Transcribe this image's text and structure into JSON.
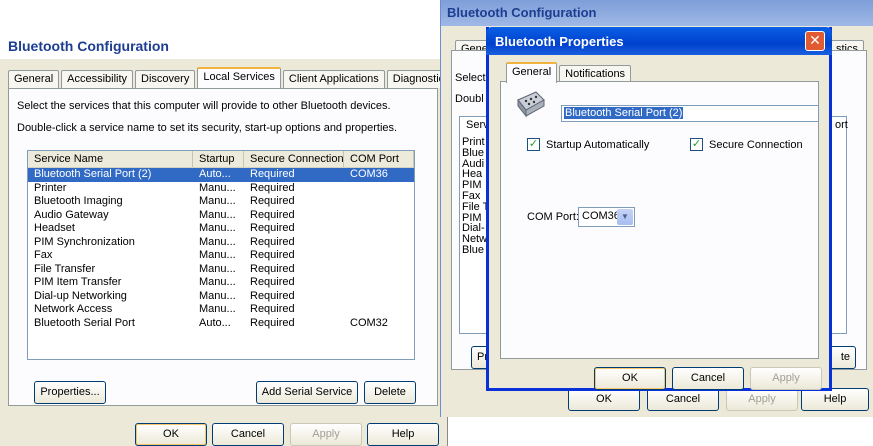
{
  "left_window": {
    "title": "Bluetooth Configuration",
    "tabs": [
      "General",
      "Accessibility",
      "Discovery",
      "Local Services",
      "Client Applications",
      "Diagnostics"
    ],
    "active_tab": "Local Services",
    "intro_line1": "Select the services that this computer will provide to other Bluetooth devices.",
    "intro_line2": "Double-click a service name to set its security, start-up options and properties.",
    "columns": [
      "Service Name",
      "Startup",
      "Secure Connection",
      "COM Port"
    ],
    "rows": [
      {
        "name": "Bluetooth Serial Port (2)",
        "startup": "Auto...",
        "secure": "Required",
        "port": "COM36"
      },
      {
        "name": "Printer",
        "startup": "Manu...",
        "secure": "Required",
        "port": ""
      },
      {
        "name": "Bluetooth Imaging",
        "startup": "Manu...",
        "secure": "Required",
        "port": ""
      },
      {
        "name": "Audio Gateway",
        "startup": "Manu...",
        "secure": "Required",
        "port": ""
      },
      {
        "name": "Headset",
        "startup": "Manu...",
        "secure": "Required",
        "port": ""
      },
      {
        "name": "PIM Synchronization",
        "startup": "Manu...",
        "secure": "Required",
        "port": ""
      },
      {
        "name": "Fax",
        "startup": "Manu...",
        "secure": "Required",
        "port": ""
      },
      {
        "name": "File Transfer",
        "startup": "Manu...",
        "secure": "Required",
        "port": ""
      },
      {
        "name": "PIM Item Transfer",
        "startup": "Manu...",
        "secure": "Required",
        "port": ""
      },
      {
        "name": "Dial-up Networking",
        "startup": "Manu...",
        "secure": "Required",
        "port": ""
      },
      {
        "name": "Network Access",
        "startup": "Manu...",
        "secure": "Required",
        "port": ""
      },
      {
        "name": "Bluetooth Serial Port",
        "startup": "Auto...",
        "secure": "Required",
        "port": "COM32"
      }
    ],
    "properties_label": "Properties...",
    "add_serial_label": "Add Serial Service",
    "delete_label": "Delete",
    "ok_label": "OK",
    "cancel_label": "Cancel",
    "apply_label": "Apply",
    "help_label": "Help"
  },
  "right_window": {
    "title": "Bluetooth Configuration",
    "tab_general": "General",
    "tab_diagnostics_fragment": "stics",
    "select_fragment": "Select",
    "double_fragment": "Doubl",
    "serv_fragment": "Serv",
    "port_fragment": "ort",
    "list_fragments": [
      "Print",
      "Blue",
      "Audi",
      "Hea",
      "PIM",
      "Fax",
      "File T",
      "PIM",
      "Dial-",
      "Netw",
      "Blue"
    ],
    "properties_fragment": "Pro",
    "delete_fragment": "te",
    "ok_label": "OK",
    "cancel_label": "Cancel",
    "apply_label": "Apply",
    "help_label": "Help"
  },
  "modal": {
    "title": "Bluetooth Properties",
    "tabs": [
      "General",
      "Notifications"
    ],
    "service_name": "Bluetooth Serial Port (2)",
    "startup_label": "Startup Automatically",
    "startup_checked": true,
    "secure_label": "Secure Connection",
    "secure_checked": true,
    "com_port_label": "COM Port:",
    "com_port_value": "COM36",
    "ok_label": "OK",
    "cancel_label": "Cancel",
    "apply_label": "Apply"
  }
}
